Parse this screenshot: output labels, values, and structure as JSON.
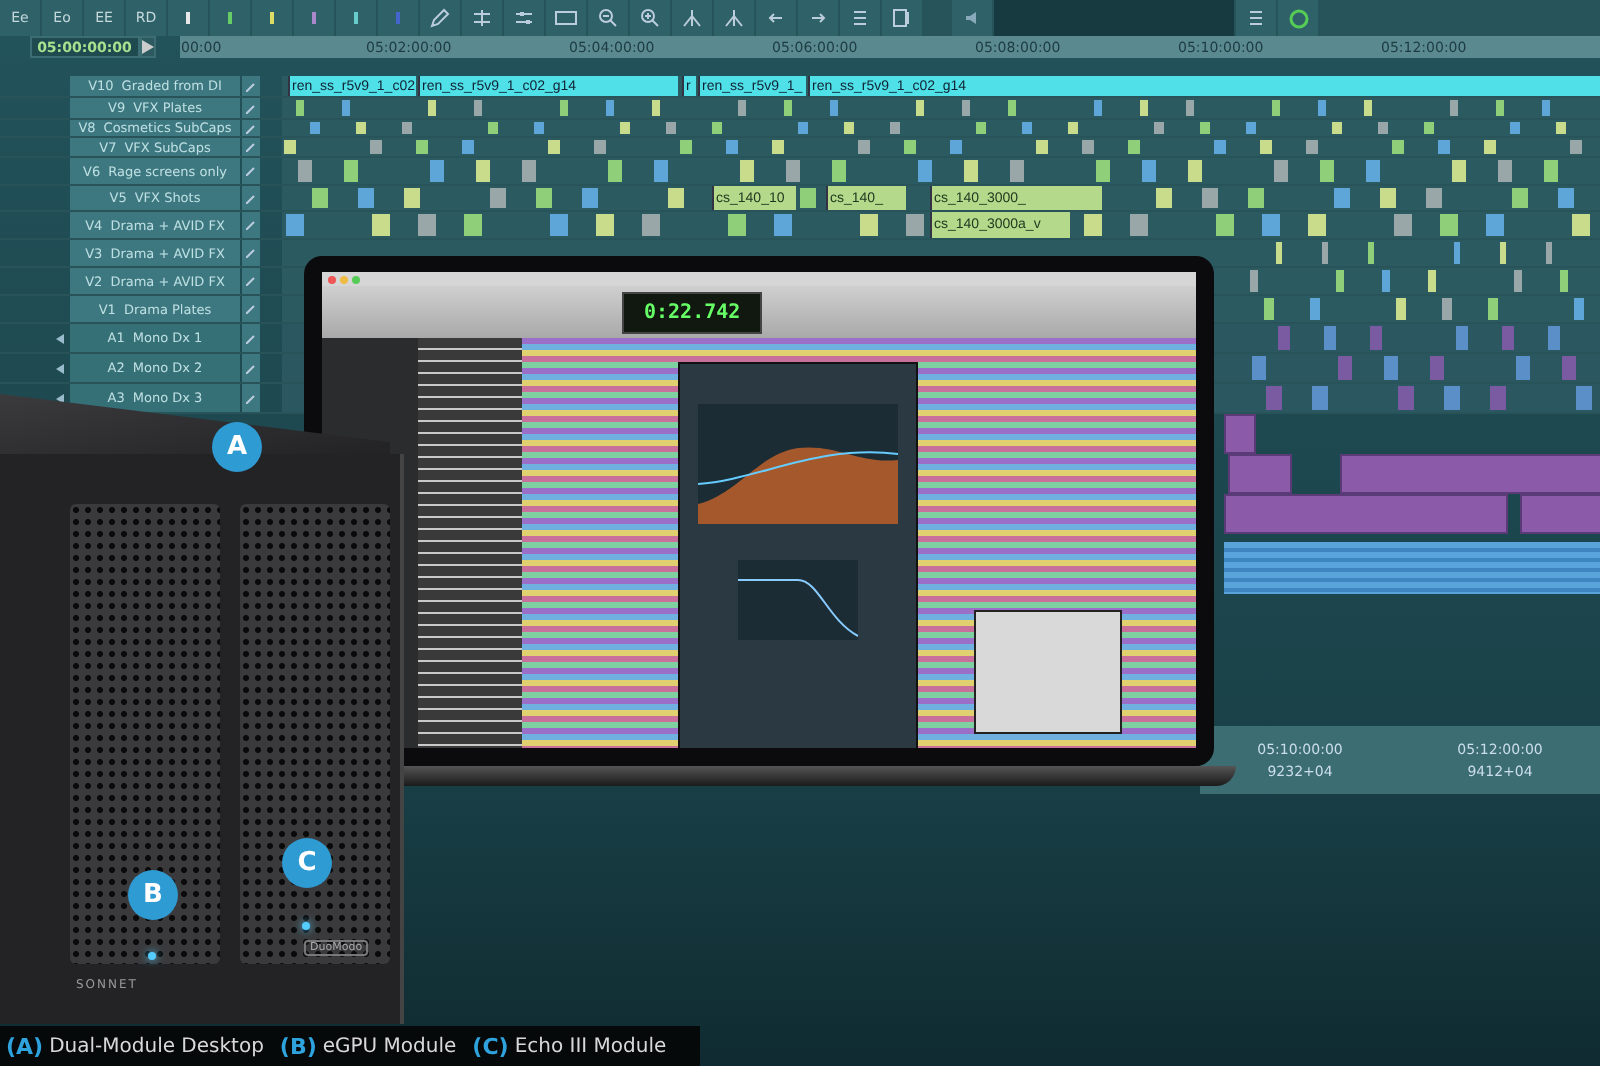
{
  "toolbar": {
    "buttons": [
      "Ee",
      "Eo",
      "EE",
      "RD"
    ]
  },
  "timecode": "05:00:00:00",
  "ruler": [
    "00:00",
    "05:02:00:00",
    "05:04:00:00",
    "05:06:00:00",
    "05:08:00:00",
    "05:10:00:00",
    "05:12:00:00"
  ],
  "tracks": [
    {
      "id": "V10",
      "name": "Graded from DI",
      "kind": "video",
      "clips": [
        "ren_ss_r5v9_1_c02",
        "ren_ss_r5v9_1_c02_g14",
        "r",
        "ren_ss_r5v9_1_",
        "ren_ss_r5v9_1_c02_g14"
      ]
    },
    {
      "id": "V9",
      "name": "VFX Plates",
      "kind": "video"
    },
    {
      "id": "V8",
      "name": "Cosmetics SubCaps",
      "kind": "video"
    },
    {
      "id": "V7",
      "name": "VFX SubCaps",
      "kind": "video"
    },
    {
      "id": "V6",
      "name": "Rage screens only",
      "kind": "video"
    },
    {
      "id": "V5",
      "name": "VFX Shots",
      "kind": "video",
      "clips": [
        "cs_140_10",
        "cs_140_",
        "cs_140_3000_"
      ]
    },
    {
      "id": "V4",
      "name": "Drama + AVID FX",
      "kind": "video",
      "clips": [
        "cs_140_3000a_v"
      ]
    },
    {
      "id": "V3",
      "name": "Drama + AVID FX",
      "kind": "video"
    },
    {
      "id": "V2",
      "name": "Drama + AVID FX",
      "kind": "video"
    },
    {
      "id": "V1",
      "name": "Drama Plates",
      "kind": "video"
    },
    {
      "id": "A1",
      "name": "Mono Dx 1",
      "kind": "audio"
    },
    {
      "id": "A2",
      "name": "Mono Dx 2",
      "kind": "audio"
    },
    {
      "id": "A3",
      "name": "Mono Dx 3",
      "kind": "audio"
    }
  ],
  "bottom_ruler": {
    "timecodes": [
      "05:10:00:00",
      "05:12:00:00"
    ],
    "feet": [
      "9232+04",
      "9412+04"
    ]
  },
  "laptop": {
    "counter": "0:22.742"
  },
  "device": {
    "brand": "SONNET",
    "module_label": "DuoModo",
    "badges": [
      "A",
      "B",
      "C"
    ]
  },
  "caption": [
    {
      "letter": "(A)",
      "label": "Dual-Module Desktop"
    },
    {
      "letter": "(B)",
      "label": "eGPU Module"
    },
    {
      "letter": "(C)",
      "label": "Echo III Module"
    }
  ]
}
